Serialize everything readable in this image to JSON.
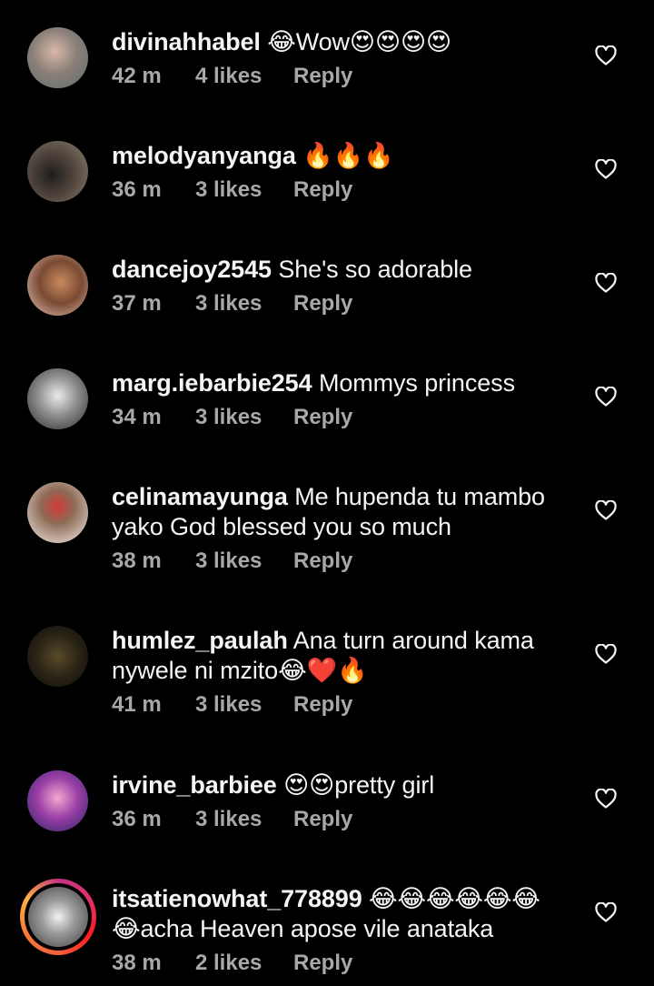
{
  "comments": [
    {
      "username": "divinahhabel",
      "text": "😂Wow😍😍😍😍",
      "time": "42 m",
      "likes": "4 likes",
      "reply": "Reply"
    },
    {
      "username": "melodyanyanga",
      "text": "🔥🔥🔥",
      "time": "36 m",
      "likes": "3 likes",
      "reply": "Reply"
    },
    {
      "username": "dancejoy2545",
      "text": "She's so adorable",
      "time": "37 m",
      "likes": "3 likes",
      "reply": "Reply"
    },
    {
      "username": "marg.iebarbie254",
      "text": "Mommys princess",
      "time": "34 m",
      "likes": "3 likes",
      "reply": "Reply"
    },
    {
      "username": "celinamayunga",
      "text": "Me hupenda tu mambo yako God blessed you so much",
      "time": "38 m",
      "likes": "3 likes",
      "reply": "Reply"
    },
    {
      "username": "humlez_paulah",
      "text": "Ana turn around kama nywele ni mzito😂❤️🔥",
      "time": "41 m",
      "likes": "3 likes",
      "reply": "Reply"
    },
    {
      "username": "irvine_barbiee",
      "text": "😍😍pretty girl",
      "time": "36 m",
      "likes": "3 likes",
      "reply": "Reply"
    },
    {
      "username": "itsatienowhat_778899",
      "text": "😂😂😂😂😂😂😂acha Heaven  apose vile anataka",
      "time": "38 m",
      "likes": "2 likes",
      "reply": "Reply"
    }
  ],
  "colors": {
    "background": "#000000",
    "text": "#f5f5f5",
    "meta": "#a8a8a8"
  },
  "icons": {
    "like": "heart-outline-icon"
  }
}
